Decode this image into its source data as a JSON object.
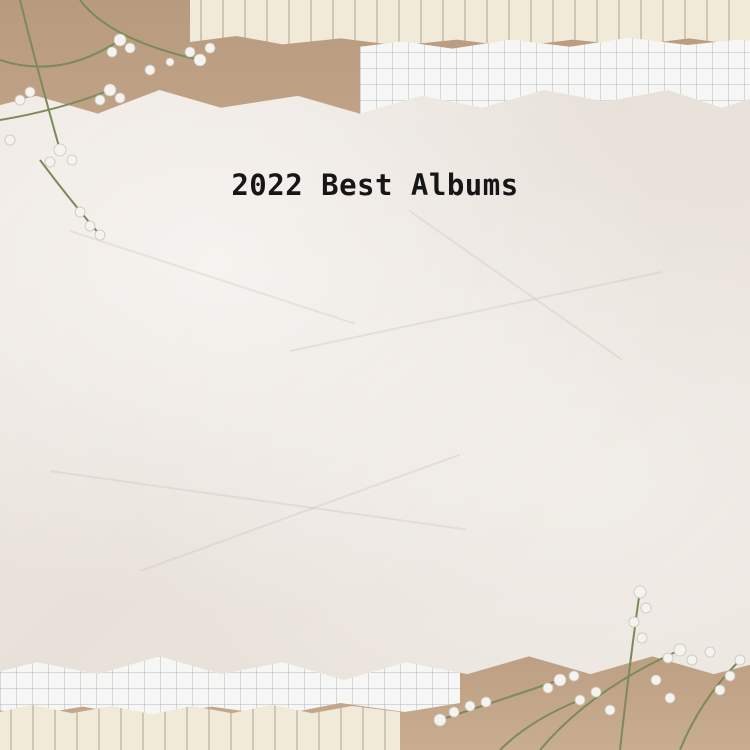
{
  "page": {
    "title": "2022 Best Albums"
  },
  "decorations": {
    "top_left": "dried-flowers",
    "bottom_right": "dried-flowers",
    "background": "crumpled-paper"
  },
  "colors": {
    "kraft": "#c2a589",
    "paper": "#ece6df",
    "text": "#161616"
  }
}
